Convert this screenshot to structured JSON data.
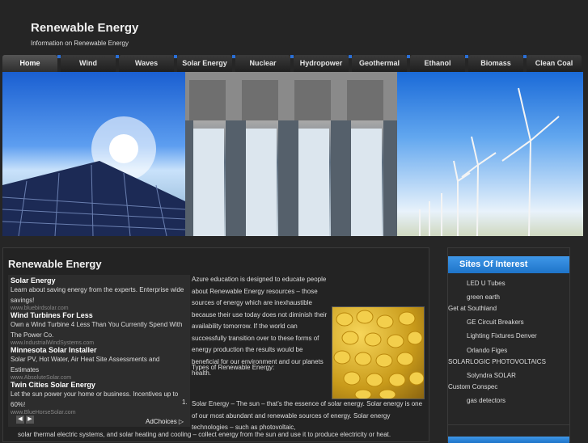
{
  "header": {
    "title": "Renewable Energy",
    "tagline": "Information on Renewable Energy"
  },
  "nav": {
    "items": [
      {
        "label": "Home",
        "active": true
      },
      {
        "label": "Wind"
      },
      {
        "label": "Waves"
      },
      {
        "label": "Solar Energy"
      },
      {
        "label": "Nuclear"
      },
      {
        "label": "Hydropower"
      },
      {
        "label": "Geothermal"
      },
      {
        "label": "Ethanol"
      },
      {
        "label": "Biomass"
      },
      {
        "label": "Clean Coal"
      }
    ]
  },
  "content": {
    "title": "Renewable Energy",
    "intro": "Azure education is designed to educate people about Renewable Energy resources – those sources of energy which are inexhaustible because their use today does not diminish their availability tomorrow.  If the world can successfully transition over to these forms of energy production the results would be beneficial for our environment and our planets health.",
    "types_heading": "Types of Renewable Energy:",
    "list_number": "1.",
    "solar_paragraph": "Solar Energy – The sun – that’s the essence of solar energy. Solar energy is one of our most abundant and renewable sources of energy. Solar energy technologies – such as photovoltaic,",
    "solar_continuation": "solar thermal electric systems, and solar heating and cooling – collect energy from the sun and use it to produce electricity or heat."
  },
  "ads": {
    "items": [
      {
        "title": "Solar Energy",
        "text": "Learn about saving energy from the experts. Enterprise wide savings!",
        "url": "www.bluebirdsolar.com"
      },
      {
        "title": "Wind Turbines For Less",
        "text": "Own a Wind Turbine 4 Less Than You Currently Spend With The Power Co.",
        "url": "www.IndustrialWindSystems.com"
      },
      {
        "title": "Minnesota Solar Installer",
        "text": "Solar PV, Hot Water, Air Heat Site Assessments and Estimates",
        "url": "www.AbsoluteSolar.com"
      },
      {
        "title": "Twin Cities Solar Energy",
        "text": "Let the sun power your home or business. Incentives up to 60%!",
        "url": "www.BlueHorseSolar.com"
      }
    ],
    "adchoices": "AdChoices ▷"
  },
  "sidebar": {
    "title": "Sites Of Interest",
    "links": [
      {
        "label": "LED U Tubes",
        "indent": true
      },
      {
        "label": "green earth",
        "indent": true
      },
      {
        "label": "Get at Southland",
        "indent": false
      },
      {
        "label": "GE Circuit Breakers",
        "indent": true
      },
      {
        "label": "Lighting Fixtures Denver",
        "indent": true
      },
      {
        "label": "Orlando Figes",
        "indent": true
      },
      {
        "label": "SOLARLOGIC PHOTOVOLTAICS",
        "indent": false
      },
      {
        "label": "Solyndra SOLAR",
        "indent": true
      },
      {
        "label": "Custom Conspec",
        "indent": false
      },
      {
        "label": "gas detectors",
        "indent": true
      }
    ]
  }
}
